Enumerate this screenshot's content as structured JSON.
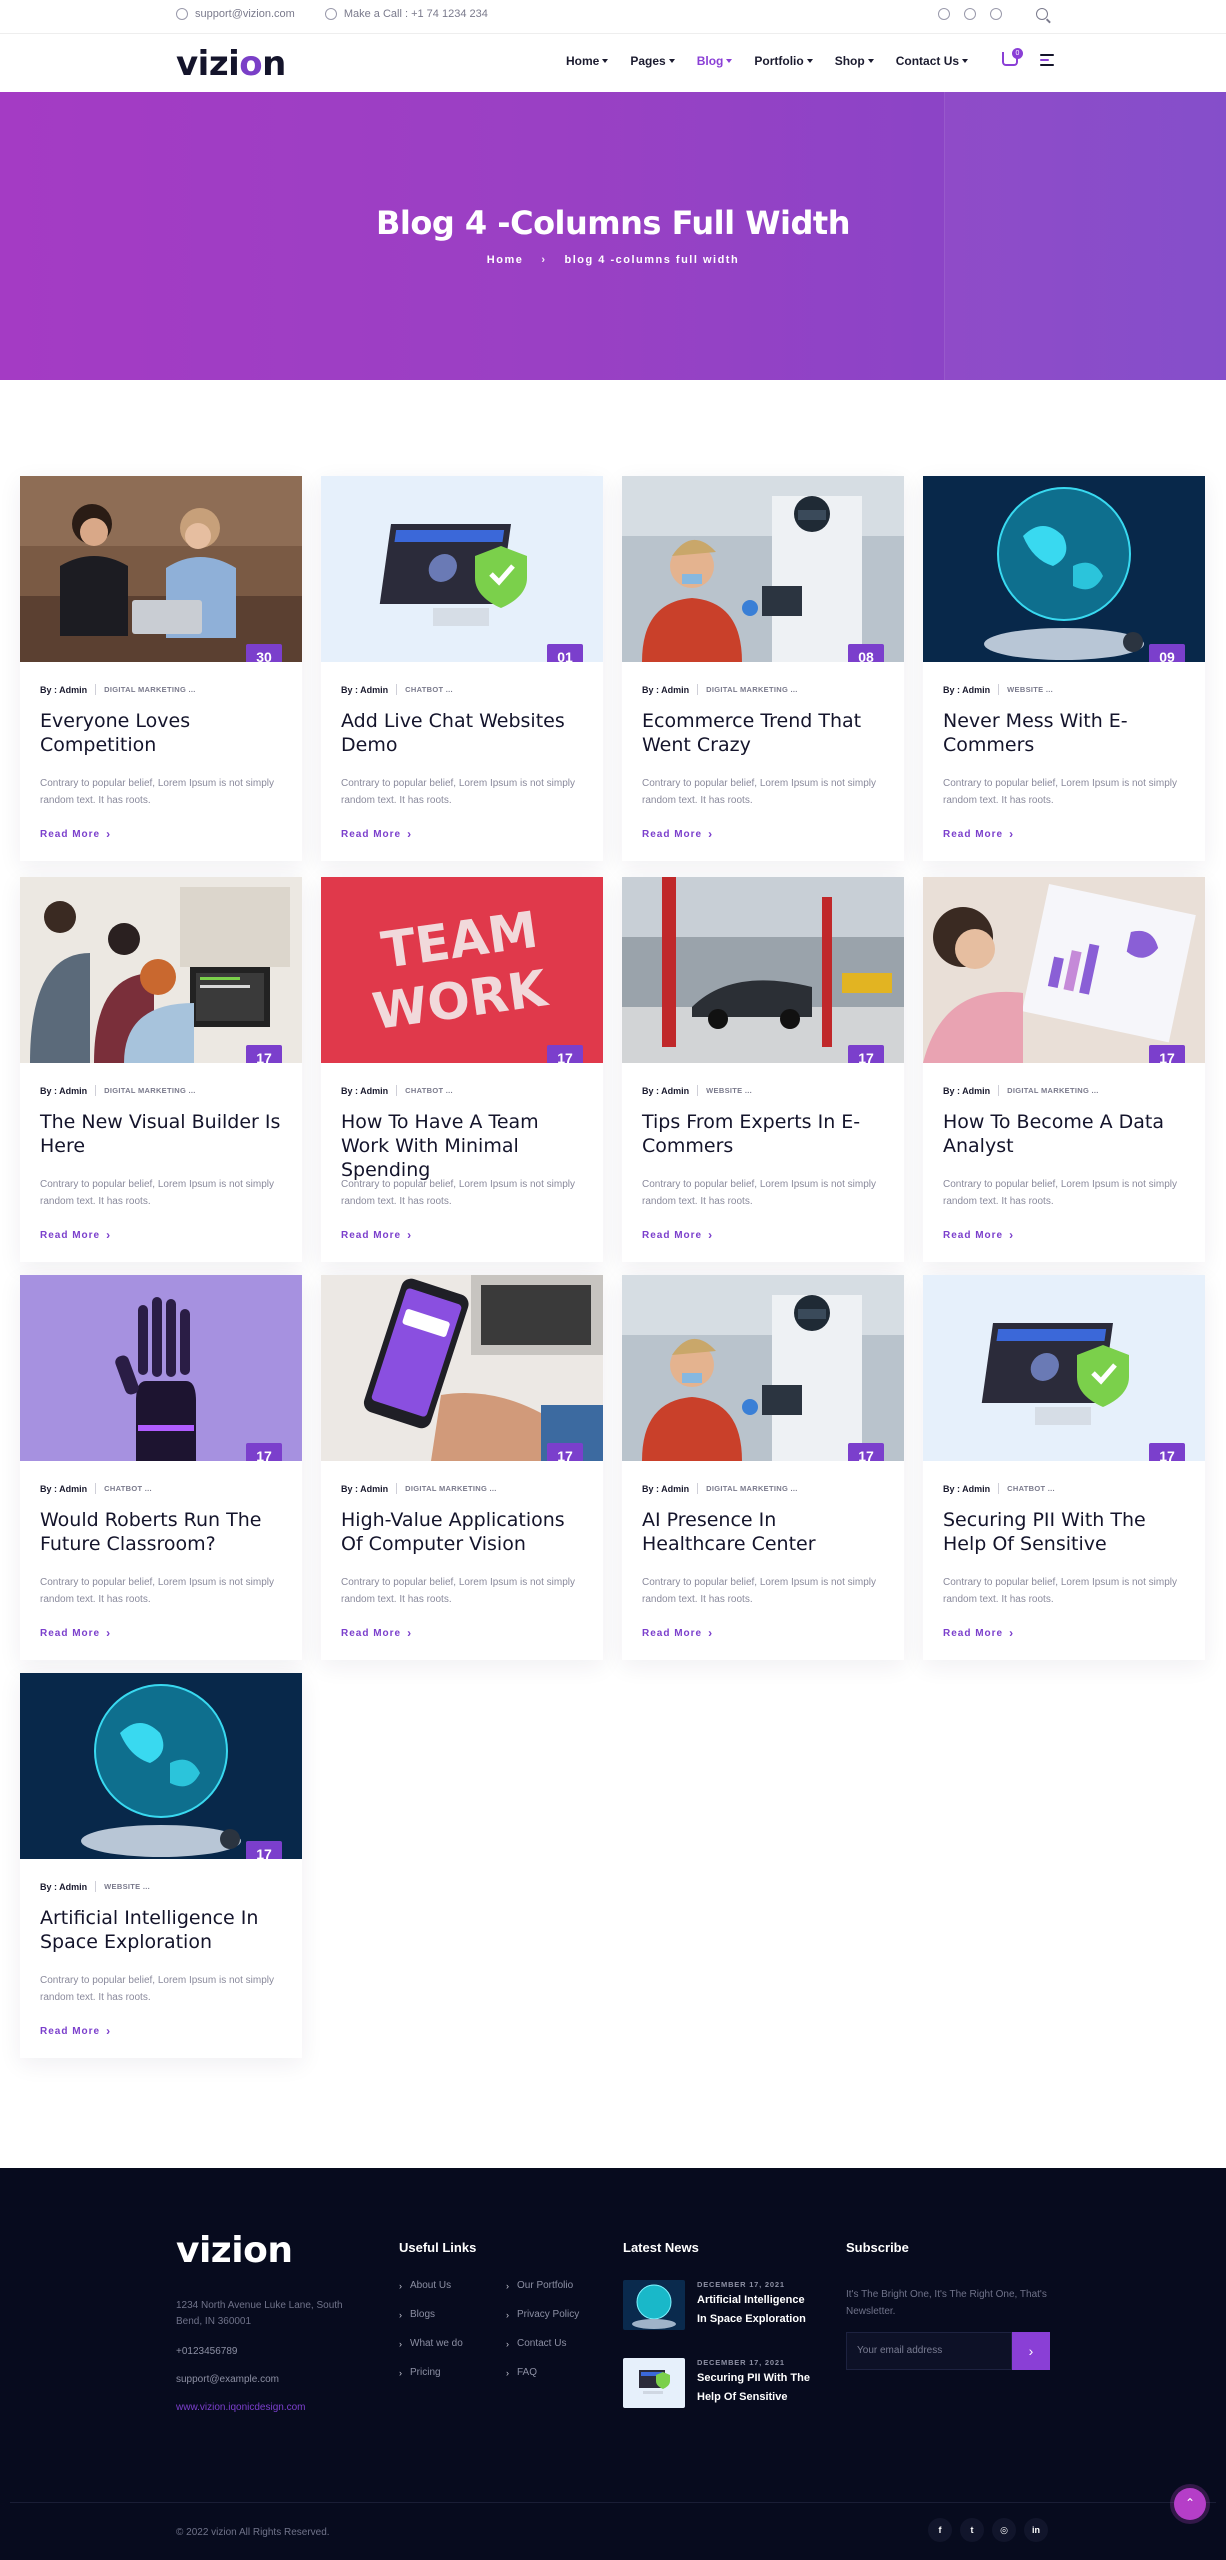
{
  "topbar": {
    "email": "support@vizion.com",
    "phone": "Make a Call : +1 74 1234 234"
  },
  "header": {
    "logo_text_start": "vizi",
    "logo_text_o": "o",
    "logo_text_end": "n",
    "nav": [
      {
        "label": "Home",
        "active": false
      },
      {
        "label": "Pages",
        "active": false
      },
      {
        "label": "Blog",
        "active": true
      },
      {
        "label": "Portfolio",
        "active": false
      },
      {
        "label": "Shop",
        "active": false
      },
      {
        "label": "Contact Us",
        "active": false
      }
    ],
    "cart_count": "0"
  },
  "hero": {
    "title": "Blog 4 -Columns Full Width",
    "breadcrumb_home": "Home",
    "breadcrumb_current": "blog 4 -columns full width"
  },
  "cards": [
    {
      "title": "Everyone Loves Competition",
      "day": "30",
      "month": "Nov",
      "author": "By : Admin",
      "category": "DIGITAL MARKETING ...",
      "excerpt": "Contrary to popular belief, Lorem Ipsum is not simply random text. It has roots.",
      "read_more": "Read More",
      "image": "women-laptop"
    },
    {
      "title": "Add Live Chat Websites Demo",
      "day": "01",
      "month": "Dec",
      "author": "By : Admin",
      "category": "CHATBOT ...",
      "excerpt": "Contrary to popular belief, Lorem Ipsum is not simply random text. It has roots.",
      "read_more": "Read More",
      "image": "monitor-shield"
    },
    {
      "title": "Ecommerce Trend That Went Crazy",
      "day": "08",
      "month": "Dec",
      "author": "By : Admin",
      "category": "DIGITAL MARKETING ...",
      "excerpt": "Contrary to popular belief, Lorem Ipsum is not simply random text. It has roots.",
      "read_more": "Read More",
      "image": "healthcare"
    },
    {
      "title": "Never Mess With E-Commers",
      "day": "09",
      "month": "Dec",
      "author": "By : Admin",
      "category": "WEBSITE ...",
      "excerpt": "Contrary to popular belief, Lorem Ipsum is not simply random text. It has roots.",
      "read_more": "Read More",
      "image": "globe-hand"
    },
    {
      "title": "The New Visual Builder Is Here",
      "day": "17",
      "month": "Dec",
      "author": "By : Admin",
      "category": "DIGITAL MARKETING ...",
      "excerpt": "Contrary to popular belief, Lorem Ipsum is not simply random text. It has roots.",
      "read_more": "Read More",
      "image": "office-team"
    },
    {
      "title": "How To Have A Team Work With Minimal Spending",
      "day": "17",
      "month": "Dec",
      "author": "By : Admin",
      "category": "CHATBOT ...",
      "excerpt": "Contrary to popular belief, Lorem Ipsum is not simply random text. It has roots.",
      "read_more": "Read More",
      "image": "team-work"
    },
    {
      "title": "Tips From Experts In E-Commers",
      "day": "17",
      "month": "Dec",
      "author": "By : Admin",
      "category": "WEBSITE ...",
      "excerpt": "Contrary to popular belief, Lorem Ipsum is not simply random text. It has roots.",
      "read_more": "Read More",
      "image": "garage"
    },
    {
      "title": "How To Become A Data Analyst",
      "day": "17",
      "month": "Dec",
      "author": "By : Admin",
      "category": "DIGITAL MARKETING ...",
      "excerpt": "Contrary to popular belief, Lorem Ipsum is not simply random text. It has roots.",
      "read_more": "Read More",
      "image": "data-analyst"
    },
    {
      "title": "Would Roberts Run The Future Classroom?",
      "day": "17",
      "month": "Dec",
      "author": "By : Admin",
      "category": "CHATBOT ...",
      "excerpt": "Contrary to popular belief, Lorem Ipsum is not simply random text. It has roots.",
      "read_more": "Read More",
      "image": "robot-hand"
    },
    {
      "title": "High-Value Applications Of Computer Vision",
      "day": "17",
      "month": "Dec",
      "author": "By : Admin",
      "category": "DIGITAL MARKETING ...",
      "excerpt": "Contrary to popular belief, Lorem Ipsum is not simply random text. It has roots.",
      "read_more": "Read More",
      "image": "phone-hand"
    },
    {
      "title": "AI Presence In Healthcare Center",
      "day": "17",
      "month": "Dec",
      "author": "By : Admin",
      "category": "DIGITAL MARKETING ...",
      "excerpt": "Contrary to popular belief, Lorem Ipsum is not simply random text. It has roots.",
      "read_more": "Read More",
      "image": "healthcare"
    },
    {
      "title": "Securing PII With The Help Of Sensitive",
      "day": "17",
      "month": "Dec",
      "author": "By : Admin",
      "category": "CHATBOT ...",
      "excerpt": "Contrary to popular belief, Lorem Ipsum is not simply random text. It has roots.",
      "read_more": "Read More",
      "image": "monitor-shield"
    },
    {
      "title": "Artificial Intelligence In Space Exploration",
      "day": "17",
      "month": "Dec",
      "author": "By : Admin",
      "category": "WEBSITE ...",
      "excerpt": "Contrary to popular belief, Lorem Ipsum is not simply random text. It has roots.",
      "read_more": "Read More",
      "image": "globe-hand"
    }
  ],
  "footer": {
    "logo_text_start": "vizi",
    "logo_text_o": "o",
    "logo_text_end": "n",
    "address": "1234 North Avenue Luke Lane, South Bend, IN 360001",
    "phone": "+0123456789",
    "email": "support@example.com",
    "website": "www.vizion.iqonicdesign.com",
    "useful_links_title": "Useful Links",
    "links_col1": [
      "About Us",
      "Blogs",
      "What we do",
      "Pricing"
    ],
    "links_col2": [
      "Our Portfolio",
      "Privacy Policy",
      "Contact Us",
      "FAQ"
    ],
    "latest_news_title": "Latest News",
    "news": [
      {
        "date": "DECEMBER 17, 2021",
        "title": "Artificial Intelligence In Space Exploration",
        "image": "globe-hand"
      },
      {
        "date": "DECEMBER 17, 2021",
        "title": "Securing PII With The Help Of Sensitive",
        "image": "monitor-shield"
      }
    ],
    "subscribe_title": "Subscribe",
    "subscribe_text": "It's The Bright One, It's The Right One, That's Newsletter.",
    "subscribe_placeholder": "Your email address",
    "copyright": "© 2022 vizion All Rights Reserved.",
    "socials": [
      "facebook-icon",
      "twitter-icon",
      "instagram-icon",
      "linkedin-icon"
    ]
  },
  "colors": {
    "accent": "#7b3fcc",
    "hero_start": "#a43bc4",
    "hero_end": "#8147c8",
    "footer_bg": "#070b1e"
  }
}
